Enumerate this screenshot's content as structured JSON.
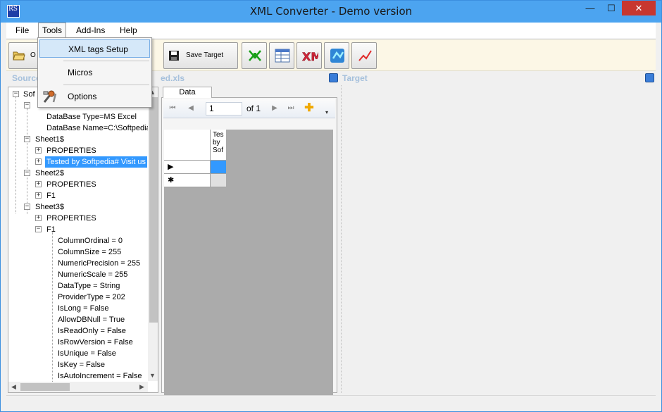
{
  "window": {
    "title": "XML Converter - Demo version",
    "app_icon_text": "RS"
  },
  "titlebar_controls": {
    "minimize": "—",
    "maximize": "☐",
    "close": "✕"
  },
  "menubar": {
    "file": "File",
    "tools": "Tools",
    "addins": "Add-Ins",
    "help": "Help"
  },
  "tools_menu": {
    "xml_tags_setup": "XML tags Setup",
    "micros": "Micros",
    "options": "Options"
  },
  "toolbar": {
    "open_label": "O",
    "save_target_label": "Save Target"
  },
  "source_panel": {
    "header_visible": "Source",
    "header_suffix": "ed.xls"
  },
  "target_panel": {
    "header": "Target"
  },
  "tree": {
    "root": "Sof",
    "info_items": [
      "DataBase Type=MS Excel",
      "DataBase Name=C:\\Softpedia"
    ],
    "sheet1": "Sheet1$",
    "sheet1_children": [
      "PROPERTIES",
      "Tested by Softpedia# Visit us"
    ],
    "sheet2": "Sheet2$",
    "sheet2_children": [
      "PROPERTIES",
      "F1"
    ],
    "sheet3": "Sheet3$",
    "sheet3_children": [
      "PROPERTIES",
      "F1"
    ],
    "f1_properties": [
      "ColumnOrdinal = 0",
      "ColumnSize = 255",
      "NumericPrecision = 255",
      "NumericScale = 255",
      "DataType = String",
      "ProviderType = 202",
      "IsLong = False",
      "AllowDBNull = True",
      "IsReadOnly = False",
      "IsRowVersion = False",
      "IsUnique = False",
      "IsKey = False",
      "IsAutoIncrement = False"
    ]
  },
  "data_panel": {
    "tab": "Data",
    "navigator": {
      "position": "1",
      "of_label": "of 1"
    },
    "column_header": [
      "Tes",
      "by",
      "Sof"
    ],
    "row_markers": [
      "▶",
      "✱"
    ]
  }
}
